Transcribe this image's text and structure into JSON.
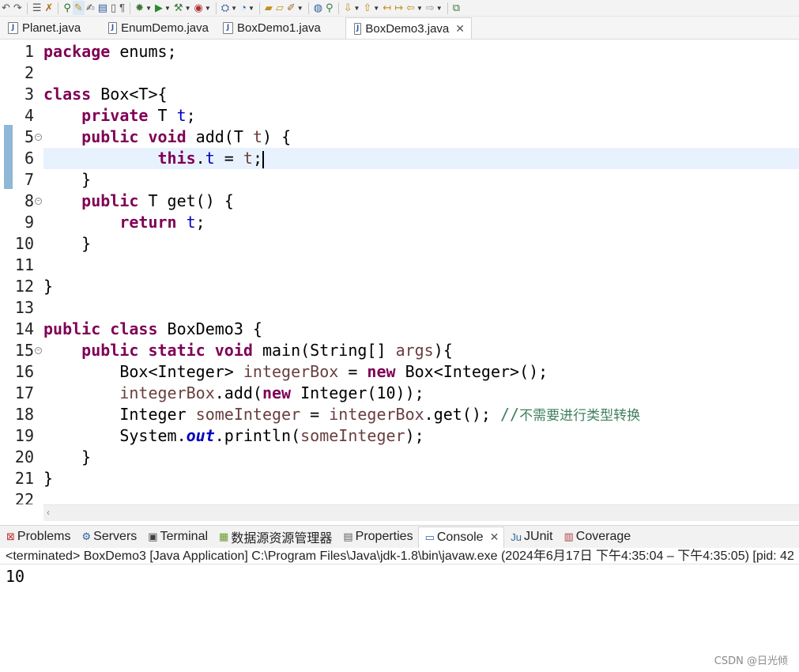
{
  "editor_tabs": [
    {
      "label": "Planet.java",
      "active": false
    },
    {
      "label": "EnumDemo.java",
      "active": false
    },
    {
      "label": "BoxDemo1.java",
      "active": false
    },
    {
      "label": "BoxDemo3.java",
      "active": true
    }
  ],
  "code": {
    "current_line": 6,
    "lines": [
      {
        "n": "1",
        "fold": false
      },
      {
        "n": "2",
        "fold": false
      },
      {
        "n": "3",
        "fold": false
      },
      {
        "n": "4",
        "fold": false
      },
      {
        "n": "5",
        "fold": true
      },
      {
        "n": "6",
        "fold": false
      },
      {
        "n": "7",
        "fold": false
      },
      {
        "n": "8",
        "fold": true
      },
      {
        "n": "9",
        "fold": false
      },
      {
        "n": "10",
        "fold": false
      },
      {
        "n": "11",
        "fold": false
      },
      {
        "n": "12",
        "fold": false
      },
      {
        "n": "13",
        "fold": false
      },
      {
        "n": "14",
        "fold": false
      },
      {
        "n": "15",
        "fold": true
      },
      {
        "n": "16",
        "fold": false
      },
      {
        "n": "17",
        "fold": false
      },
      {
        "n": "18",
        "fold": false
      },
      {
        "n": "19",
        "fold": false
      },
      {
        "n": "20",
        "fold": false
      },
      {
        "n": "21",
        "fold": false
      },
      {
        "n": "22",
        "fold": false
      }
    ],
    "tokens": {
      "l1": [
        [
          "kw",
          "package"
        ],
        [
          "p",
          " enums;"
        ]
      ],
      "l2": [],
      "l3": [
        [
          "kw",
          "class"
        ],
        [
          "p",
          " Box<T>{"
        ]
      ],
      "l4": [
        [
          "p",
          "    "
        ],
        [
          "kw",
          "private"
        ],
        [
          "p",
          " T "
        ],
        [
          "fld",
          "t"
        ],
        [
          "p",
          ";"
        ]
      ],
      "l5": [
        [
          "p",
          "    "
        ],
        [
          "kw",
          "public"
        ],
        [
          "p",
          " "
        ],
        [
          "kw",
          "void"
        ],
        [
          "p",
          " add(T "
        ],
        [
          "unused",
          "t"
        ],
        [
          "p",
          ") {"
        ]
      ],
      "l6": [
        [
          "p",
          "            "
        ],
        [
          "kw",
          "this"
        ],
        [
          "p",
          "."
        ],
        [
          "fld",
          "t"
        ],
        [
          "p",
          " = "
        ],
        [
          "unused",
          "t"
        ],
        [
          "p",
          ";"
        ]
      ],
      "l7": [
        [
          "p",
          "    }"
        ]
      ],
      "l8": [
        [
          "p",
          "    "
        ],
        [
          "kw",
          "public"
        ],
        [
          "p",
          " T get() {"
        ]
      ],
      "l9": [
        [
          "p",
          "        "
        ],
        [
          "kw",
          "return"
        ],
        [
          "p",
          " "
        ],
        [
          "fld",
          "t"
        ],
        [
          "p",
          ";"
        ]
      ],
      "l10": [
        [
          "p",
          "    }"
        ]
      ],
      "l11": [],
      "l12": [
        [
          "p",
          "}"
        ]
      ],
      "l13": [],
      "l14": [
        [
          "kw",
          "public"
        ],
        [
          "p",
          " "
        ],
        [
          "kw",
          "class"
        ],
        [
          "p",
          " BoxDemo3 {"
        ]
      ],
      "l15": [
        [
          "p",
          "    "
        ],
        [
          "kw",
          "public"
        ],
        [
          "p",
          " "
        ],
        [
          "kw",
          "static"
        ],
        [
          "p",
          " "
        ],
        [
          "kw",
          "void"
        ],
        [
          "p",
          " main(String[] "
        ],
        [
          "unused",
          "args"
        ],
        [
          "p",
          "){"
        ]
      ],
      "l16": [
        [
          "p",
          "        Box<Integer> "
        ],
        [
          "unused",
          "integerBox"
        ],
        [
          "p",
          " = "
        ],
        [
          "kw",
          "new"
        ],
        [
          "p",
          " Box<Integer>();"
        ]
      ],
      "l17": [
        [
          "p",
          "        "
        ],
        [
          "unused",
          "integerBox"
        ],
        [
          "p",
          ".add("
        ],
        [
          "kw",
          "new"
        ],
        [
          "p",
          " Integer(10));"
        ]
      ],
      "l18": [
        [
          "p",
          "        Integer "
        ],
        [
          "unused",
          "someInteger"
        ],
        [
          "p",
          " = "
        ],
        [
          "unused",
          "integerBox"
        ],
        [
          "p",
          ".get(); "
        ],
        [
          "cmt",
          "//"
        ],
        [
          "cmtcn",
          "不需要进行类型转换"
        ]
      ],
      "l19": [
        [
          "p",
          "        System."
        ],
        [
          "sfld",
          "out"
        ],
        [
          "p",
          ".println("
        ],
        [
          "unused",
          "someInteger"
        ],
        [
          "p",
          ");"
        ]
      ],
      "l20": [
        [
          "p",
          "    }"
        ]
      ],
      "l21": [
        [
          "p",
          "}"
        ]
      ],
      "l22": []
    }
  },
  "panel_tabs": [
    {
      "label": "Problems",
      "icon": "problems-icon",
      "glyph": "⊠",
      "color": "#c03030",
      "active": false
    },
    {
      "label": "Servers",
      "icon": "servers-icon",
      "glyph": "⚙",
      "color": "#3060a0",
      "active": false
    },
    {
      "label": "Terminal",
      "icon": "terminal-icon",
      "glyph": "▣",
      "color": "#404040",
      "active": false
    },
    {
      "label": "数据源资源管理器",
      "icon": "data-source-explorer-icon",
      "glyph": "▦",
      "color": "#6a9a30",
      "active": false
    },
    {
      "label": "Properties",
      "icon": "properties-icon",
      "glyph": "▤",
      "color": "#606060",
      "active": false
    },
    {
      "label": "Console",
      "icon": "console-icon",
      "glyph": "▭",
      "color": "#3060a0",
      "active": true
    },
    {
      "label": "JUnit",
      "icon": "junit-icon",
      "glyph": "Ju",
      "color": "#2a6a9a",
      "active": false
    },
    {
      "label": "Coverage",
      "icon": "coverage-icon",
      "glyph": "▥",
      "color": "#b04040",
      "active": false
    }
  ],
  "console": {
    "status": "<terminated> BoxDemo3 [Java Application] C:\\Program Files\\Java\\jdk-1.8\\bin\\javaw.exe  (2024年6月17日 下午4:35:04 – 下午4:35:05) [pid: 42",
    "output": "10"
  },
  "watermark": "CSDN @日光倾"
}
